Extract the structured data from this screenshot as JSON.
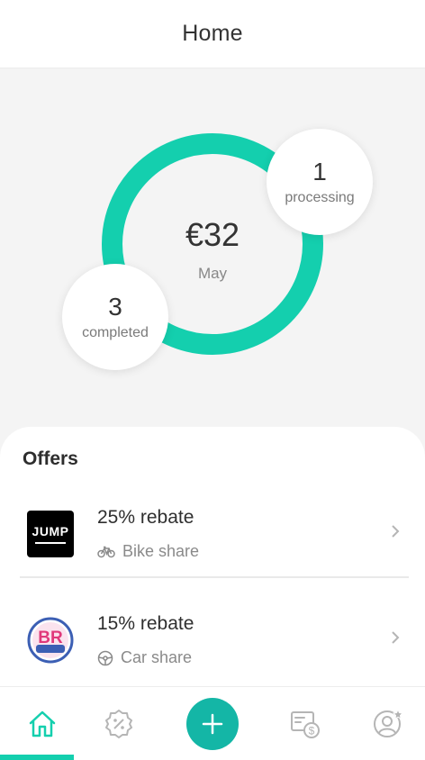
{
  "header": {
    "title": "Home"
  },
  "summary": {
    "amount": "€32",
    "month": "May",
    "processing": {
      "count": "1",
      "label": "processing"
    },
    "completed": {
      "count": "3",
      "label": "completed"
    }
  },
  "offers": {
    "heading": "Offers",
    "items": [
      {
        "brand_logo": "JUMP",
        "title": "25% rebate",
        "category": "Bike share",
        "category_icon": "bike-icon"
      },
      {
        "brand_logo": "BR",
        "title": "15% rebate",
        "category": "Car share",
        "category_icon": "steering-wheel-icon"
      }
    ]
  },
  "tabbar": {
    "items": [
      "home-icon",
      "offers-badge-icon",
      "add-icon",
      "claims-icon",
      "profile-star-icon"
    ],
    "active": "home"
  },
  "colors": {
    "accent": "#14cfae",
    "add_button": "#14b6a6"
  }
}
